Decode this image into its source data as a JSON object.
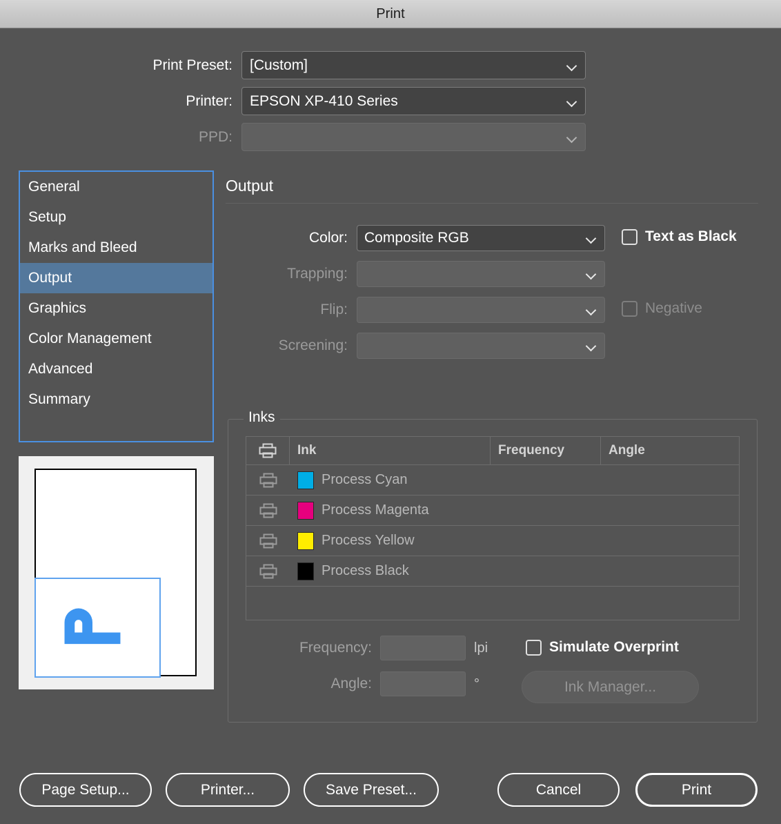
{
  "window": {
    "title": "Print"
  },
  "top_fields": [
    {
      "label": "Print Preset:",
      "value": "[Custom]",
      "disabled": false,
      "name": "print-preset"
    },
    {
      "label": "Printer:",
      "value": "EPSON XP-410 Series",
      "disabled": false,
      "name": "printer"
    },
    {
      "label": "PPD:",
      "value": "",
      "disabled": true,
      "name": "ppd"
    }
  ],
  "sidebar": {
    "items": [
      {
        "label": "General",
        "selected": false
      },
      {
        "label": "Setup",
        "selected": false
      },
      {
        "label": "Marks and Bleed",
        "selected": false
      },
      {
        "label": "Output",
        "selected": true
      },
      {
        "label": "Graphics",
        "selected": false
      },
      {
        "label": "Color Management",
        "selected": false
      },
      {
        "label": "Advanced",
        "selected": false
      },
      {
        "label": "Summary",
        "selected": false
      }
    ]
  },
  "panel": {
    "title": "Output",
    "fields": [
      {
        "label": "Color:",
        "value": "Composite RGB",
        "disabled": false,
        "name": "color"
      },
      {
        "label": "Trapping:",
        "value": "",
        "disabled": true,
        "name": "trapping"
      },
      {
        "label": "Flip:",
        "value": "",
        "disabled": true,
        "name": "flip"
      },
      {
        "label": "Screening:",
        "value": "",
        "disabled": true,
        "name": "screening"
      }
    ],
    "checkboxes": [
      {
        "label": "Text as Black",
        "checked": false,
        "disabled": false,
        "name": "text-as-black"
      },
      {
        "label": "Negative",
        "checked": false,
        "disabled": true,
        "name": "negative"
      }
    ]
  },
  "inks": {
    "legend": "Inks",
    "columns": [
      "",
      "Ink",
      "Frequency",
      "Angle"
    ],
    "print_column_icon": "printer-icon",
    "rows": [
      {
        "ink": "Process Cyan",
        "color": "#00aee6",
        "frequency": "",
        "angle": ""
      },
      {
        "ink": "Process Magenta",
        "color": "#e6007e",
        "frequency": "",
        "angle": ""
      },
      {
        "ink": "Process Yellow",
        "color": "#ffed00",
        "frequency": "",
        "angle": ""
      },
      {
        "ink": "Process Black",
        "color": "#000000",
        "frequency": "",
        "angle": ""
      }
    ],
    "frequency": {
      "label": "Frequency:",
      "value": "",
      "unit": "lpi"
    },
    "angle": {
      "label": "Angle:",
      "value": "",
      "unit": "°"
    },
    "simulate_overprint": {
      "label": "Simulate Overprint",
      "checked": false
    },
    "ink_manager": {
      "label": "Ink Manager...",
      "disabled": true
    }
  },
  "footer": {
    "buttons": [
      {
        "label": "Page Setup...",
        "default": false,
        "name": "page-setup"
      },
      {
        "label": "Printer...",
        "default": false,
        "name": "printer-dialog"
      },
      {
        "label": "Save Preset...",
        "default": false,
        "name": "save-preset"
      },
      {
        "label": "Cancel",
        "default": false,
        "name": "cancel"
      },
      {
        "label": "Print",
        "default": true,
        "name": "print"
      }
    ]
  },
  "colors": {
    "accent": "#4a90e2",
    "selection": "#54789c",
    "background": "#545454",
    "titlebar": "#c9c9c9"
  }
}
